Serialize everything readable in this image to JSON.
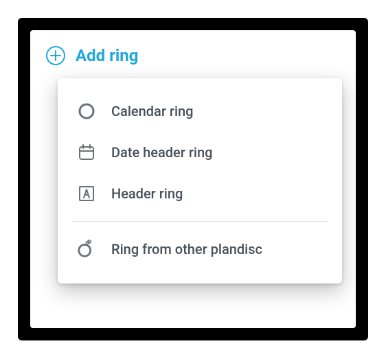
{
  "header": {
    "add_ring_label": "Add ring"
  },
  "menu": {
    "items": [
      {
        "label": "Calendar ring"
      },
      {
        "label": "Date header ring"
      },
      {
        "label": "Header ring"
      },
      {
        "label": "Ring from other plandisc"
      }
    ]
  },
  "colors": {
    "accent": "#1ea7e0",
    "icon": "#6b7177",
    "text": "#495057"
  }
}
